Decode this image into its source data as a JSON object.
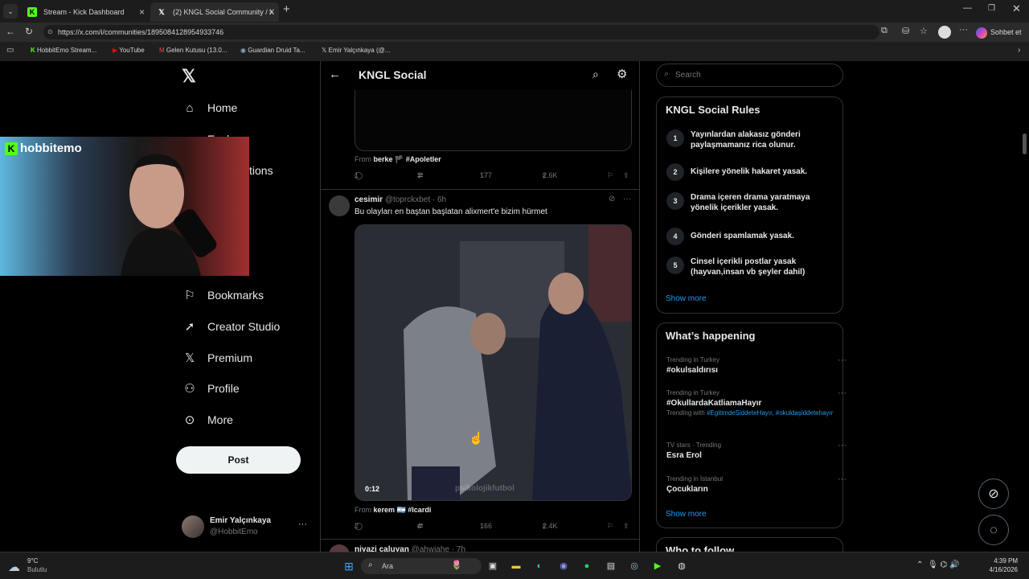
{
  "browser": {
    "tabs": [
      {
        "title": "Stream - Kick Dashboard",
        "icon": "kick-icon"
      },
      {
        "title": "(2) KNGL Social Community / X",
        "icon": "x-logo-icon"
      }
    ],
    "url": "https://x.com/i/communities/1895084128954933746",
    "profile_button": "Sohbet et",
    "bookmarks": [
      "HobbitEmo Stream...",
      "YouTube",
      "Gelen Kutusu (13.0...",
      "Guardian Druid Ta...",
      "Emir Yalçınkaya (@..."
    ]
  },
  "stream_overlay": {
    "label": "hobbitemo"
  },
  "sidebar": {
    "items": [
      {
        "label": "Home",
        "icon": "home-icon"
      },
      {
        "label": "Explore",
        "icon": "search-icon"
      },
      {
        "label": "Notifications",
        "icon": "bell-icon"
      },
      {
        "label": "Bookmarks",
        "icon": "bookmark-icon"
      },
      {
        "label": "Creator Studio",
        "icon": "rocket-icon"
      },
      {
        "label": "Premium",
        "icon": "x-logo-icon"
      },
      {
        "label": "Profile",
        "icon": "person-icon"
      },
      {
        "label": "More",
        "icon": "more-circle-icon"
      }
    ],
    "partial_labels": {
      "explore": "Explore",
      "notifications": "tions"
    },
    "post_label": "Post",
    "account": {
      "name": "Emir Yalçınkaya",
      "handle": "@HobbitEmo"
    }
  },
  "header": {
    "title": "KNGL Social"
  },
  "posts": [
    {
      "from_prefix": "From",
      "from_user": "berke",
      "from_tag": "#Apoletler",
      "stats": {
        "replies": "1",
        "reposts": "3",
        "likes": "177",
        "views": "2.6K"
      }
    },
    {
      "author": "cesimir",
      "handle": "@toprckxbet",
      "time": "· 6h",
      "text": "Bu olayları en baştan başlatan alixmert'e bizim hürmet",
      "video_time": "0:12",
      "watermark": "psikolojikfutbol",
      "from_prefix": "From",
      "from_user": "kerem",
      "from_tag": "#Icardi",
      "stats": {
        "replies": "2",
        "reposts": "4",
        "likes": "166",
        "views": "2.4K"
      }
    },
    {
      "author": "niyazi caluyan",
      "handle": "@ahwiahe",
      "time": "· 7h"
    }
  ],
  "search": {
    "placeholder": "Search"
  },
  "rules": {
    "title": "KNGL Social Rules",
    "items": [
      {
        "n": "1",
        "text": "Yayınlardan alakasız gönderi paylaşmamanız rica olunur."
      },
      {
        "n": "2",
        "text": "Kişilere yönelik hakaret yasak."
      },
      {
        "n": "3",
        "text": "Drama içeren drama yaratmaya yönelik içerikler yasak."
      },
      {
        "n": "4",
        "text": "Gönderi spamlamak yasak."
      },
      {
        "n": "5",
        "text": "Cinsel içerikli postlar yasak (hayvan,insan vb şeyler dahil)"
      }
    ],
    "show_more": "Show more"
  },
  "happening": {
    "title": "What’s happening",
    "trends": [
      {
        "context": "Trending in Turkey",
        "name": "#okulsaldırısı"
      },
      {
        "context": "Trending in Turkey",
        "name": "#OkullardaKatliamaHayır",
        "with_prefix": "Trending with",
        "with_tags": "#EgitimdeSiddeteHayır, #okuldaşiddetehayır"
      },
      {
        "context": "TV stars · Trending",
        "name": "Esra Erol"
      },
      {
        "context": "Trending in İstanbul",
        "name": "Çocukların"
      }
    ],
    "show_more": "Show more"
  },
  "who_to_follow": {
    "title": "Who to follow"
  },
  "taskbar": {
    "weather_temp": "9°C",
    "weather_desc": "Bulutlu",
    "search_label": "Ara",
    "time": "4:39 PM",
    "date": "4/16/2026"
  },
  "colors": {
    "accent": "#1d9bf0",
    "kick": "#53fc18",
    "border": "#2f3336",
    "muted": "#71767b"
  }
}
